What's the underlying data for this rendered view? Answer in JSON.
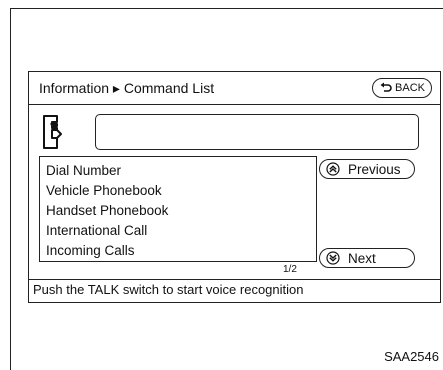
{
  "header": {
    "title": "Information ▸ Command List",
    "back_label": "BACK"
  },
  "voice_field": {
    "value": ""
  },
  "command_list": {
    "items": [
      "Dial Number",
      "Vehicle Phonebook",
      "Handset Phonebook",
      "International Call",
      "Incoming Calls"
    ],
    "page_indicator": "1/2"
  },
  "nav": {
    "previous_label": "Previous",
    "next_label": "Next"
  },
  "status": {
    "text": "Push the TALK switch to start voice recognition"
  },
  "figure": {
    "code": "SAA2546"
  },
  "icons": {
    "back": "back-arrow-icon",
    "phone": "phone-handset-icon",
    "previous": "double-chevron-up-icon",
    "next": "double-chevron-down-icon"
  }
}
